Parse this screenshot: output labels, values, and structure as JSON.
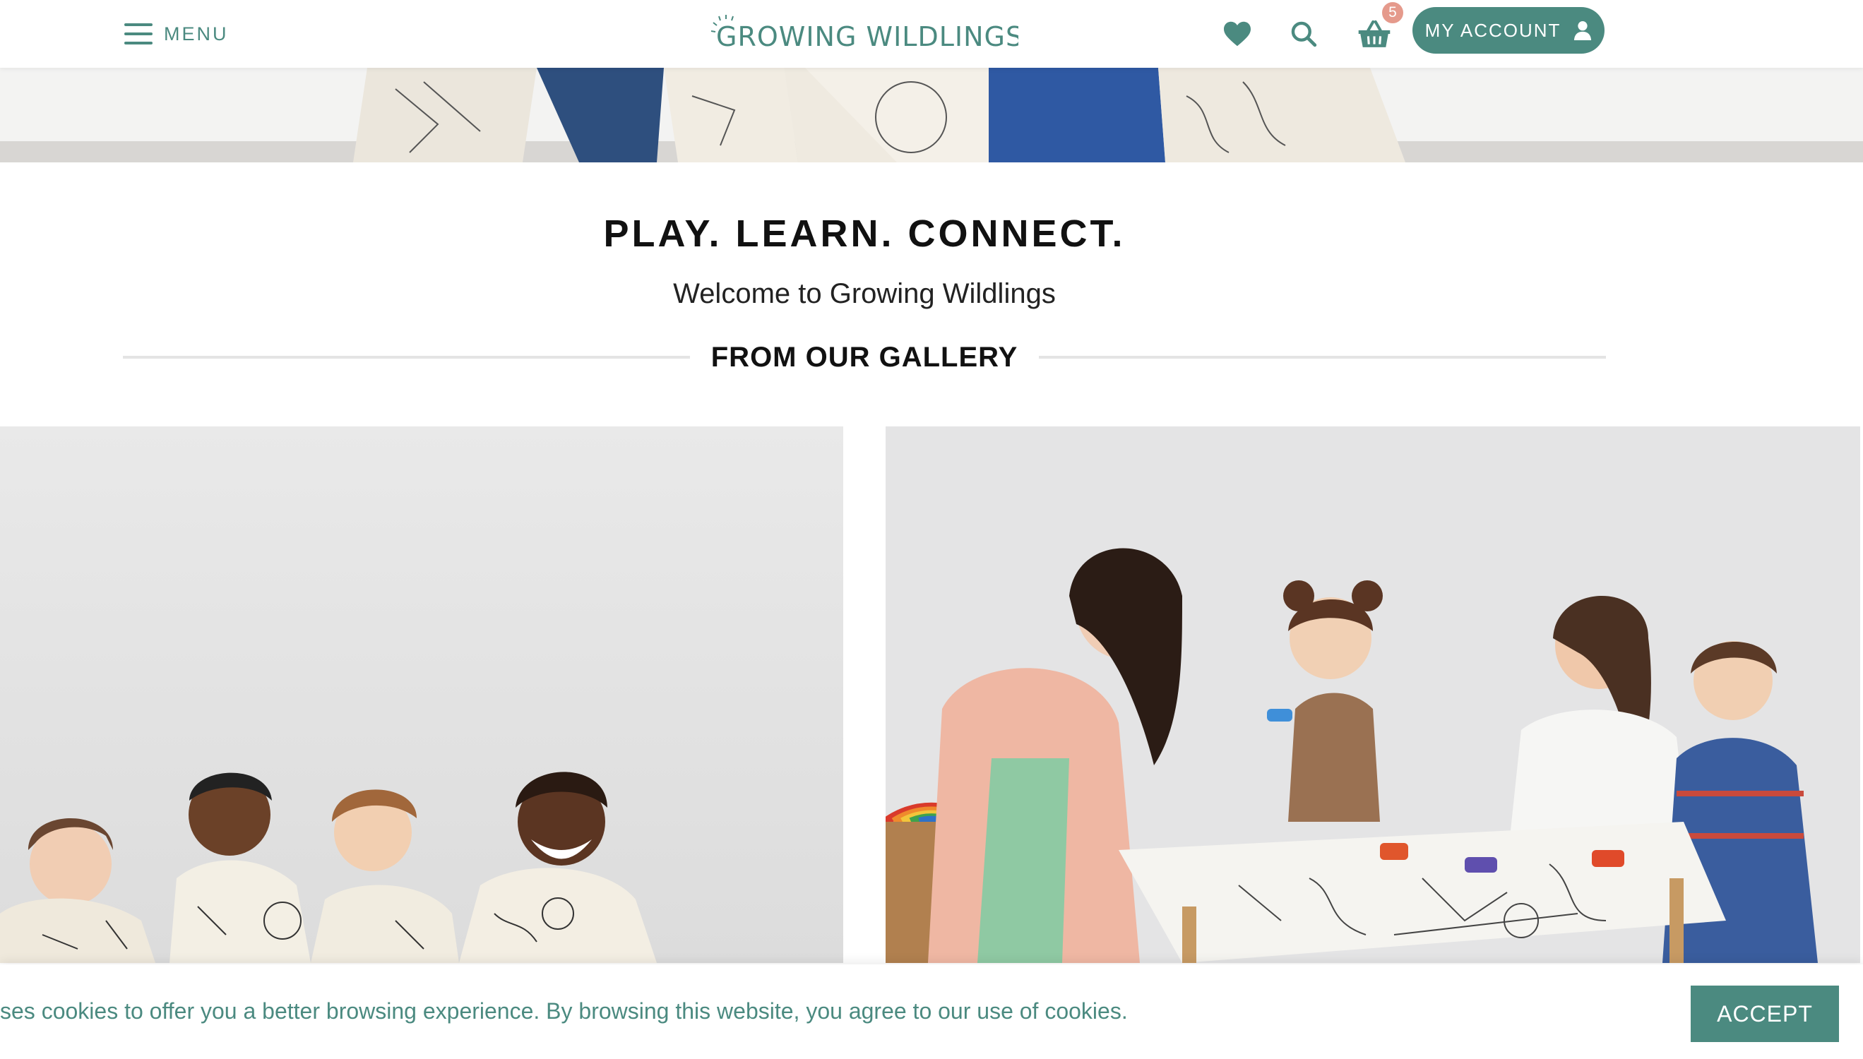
{
  "header": {
    "menu_label": "MENU",
    "logo_text": "GROWING WILDLINGS",
    "cart_count": "5",
    "account_label": "MY ACCOUNT",
    "icons": [
      "menu-icon",
      "heart-icon",
      "search-icon",
      "basket-icon",
      "user-icon"
    ]
  },
  "intro": {
    "headline": "PLAY. LEARN. CONNECT.",
    "subline": "Welcome to Growing Wildlings",
    "gallery_title": "FROM OUR GALLERY"
  },
  "cookie": {
    "text": "ses cookies to offer you a better browsing experience. By browsing this website, you agree to our use of cookies.",
    "accept_label": "ACCEPT"
  },
  "colors": {
    "brand": "#4b8a80",
    "badge": "#e59a8c"
  }
}
